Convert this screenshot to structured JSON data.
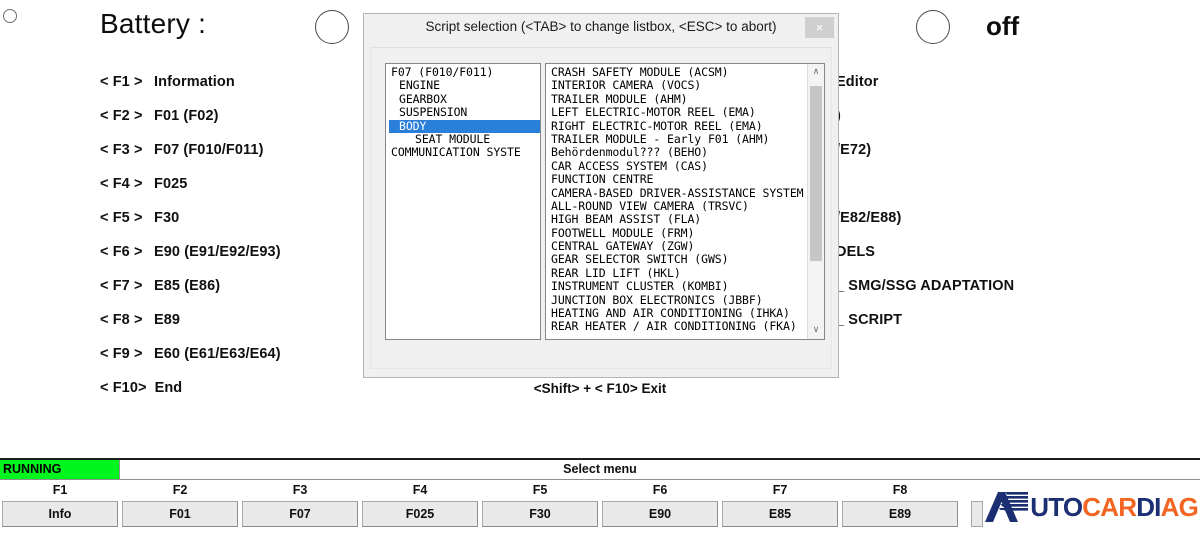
{
  "header": {
    "battery_label": "Battery :",
    "off_label": "off",
    "radio_small": "radio-indicator",
    "radio_mid": "radio-indicator",
    "radio_right": "radio-indicator"
  },
  "left_menu": [
    {
      "key": "< F1 >",
      "text": "Information"
    },
    {
      "key": "< F2 >",
      "text": "F01 (F02)"
    },
    {
      "key": "< F3 >",
      "text": "F07 (F010/F011)"
    },
    {
      "key": "< F4 >",
      "text": "F025"
    },
    {
      "key": "< F5 >",
      "text": "F30"
    },
    {
      "key": "< F6 >",
      "text": "E90 (E91/E92/E93)"
    },
    {
      "key": "< F7 >",
      "text": "E85 (E86)"
    },
    {
      "key": "< F8 >",
      "text": "E89"
    },
    {
      "key": "< F9 >",
      "text": "E60 (E61/E63/E64)"
    },
    {
      "key": "< F10>",
      "text": "End"
    }
  ],
  "right_column": [
    "Editor",
    ")",
    "/E72)",
    "",
    "/E82/E88)",
    "DELS",
    "_ SMG/SSG ADAPTATION",
    "_ SCRIPT"
  ],
  "dialog": {
    "title": "Script selection   (<TAB> to change listbox, <ESC> to abort)",
    "close_label": "×",
    "exit_hint": "<Shift> + < F10>  Exit",
    "left_list": [
      {
        "label": "F07 (F010/F011)",
        "indent": 0,
        "selected": false
      },
      {
        "label": "ENGINE",
        "indent": 1,
        "selected": false
      },
      {
        "label": "GEARBOX",
        "indent": 1,
        "selected": false
      },
      {
        "label": "SUSPENSION",
        "indent": 1,
        "selected": false
      },
      {
        "label": "BODY",
        "indent": 1,
        "selected": true
      },
      {
        "label": "SEAT MODULE",
        "indent": 2,
        "selected": false
      },
      {
        "label": "COMMUNICATION SYSTE",
        "indent": 0,
        "selected": false
      }
    ],
    "right_list": [
      "CRASH SAFETY MODULE (ACSM)",
      "INTERIOR CAMERA (VOCS)",
      "TRAILER MODULE (AHM)",
      "LEFT ELECTRIC-MOTOR REEL (EMA)",
      "RIGHT ELECTRIC-MOTOR REEL (EMA)",
      "TRAILER MODULE - Early F01 (AHM)",
      "Behördenmodul??? (BEHO)",
      "CAR ACCESS SYSTEM (CAS)",
      "FUNCTION CENTRE",
      "CAMERA-BASED DRIVER-ASSISTANCE SYSTEM",
      "ALL-ROUND VIEW CAMERA (TRSVC)",
      "HIGH BEAM ASSIST (FLA)",
      "FOOTWELL MODULE (FRM)",
      "CENTRAL GATEWAY (ZGW)",
      "GEAR SELECTOR SWITCH (GWS)",
      "REAR LID LIFT (HKL)",
      "INSTRUMENT CLUSTER (KOMBI)",
      "JUNCTION BOX ELECTRONICS (JBBF)",
      "HEATING AND AIR CONDITIONING (IHKA)",
      "REAR HEATER / AIR CONDITIONING (FKA)"
    ],
    "scrollbar": {
      "up_arrow": "∧",
      "down_arrow": "∨"
    }
  },
  "status_bar": {
    "running_label": "RUNNING",
    "running_color": "#00f61d",
    "center_label": "Select menu"
  },
  "function_keys": [
    {
      "key": "F1",
      "label": "Info"
    },
    {
      "key": "F2",
      "label": "F01"
    },
    {
      "key": "F3",
      "label": "F07"
    },
    {
      "key": "F4",
      "label": "F025"
    },
    {
      "key": "F5",
      "label": "F30"
    },
    {
      "key": "F6",
      "label": "E90"
    },
    {
      "key": "F7",
      "label": "E85"
    },
    {
      "key": "F8",
      "label": "E89"
    }
  ],
  "logo": {
    "part1": "UTO",
    "part2": "CAR",
    "part3": "DI",
    "part4": "AG",
    "navy": "#1b2f72",
    "orange": "#f26522"
  }
}
